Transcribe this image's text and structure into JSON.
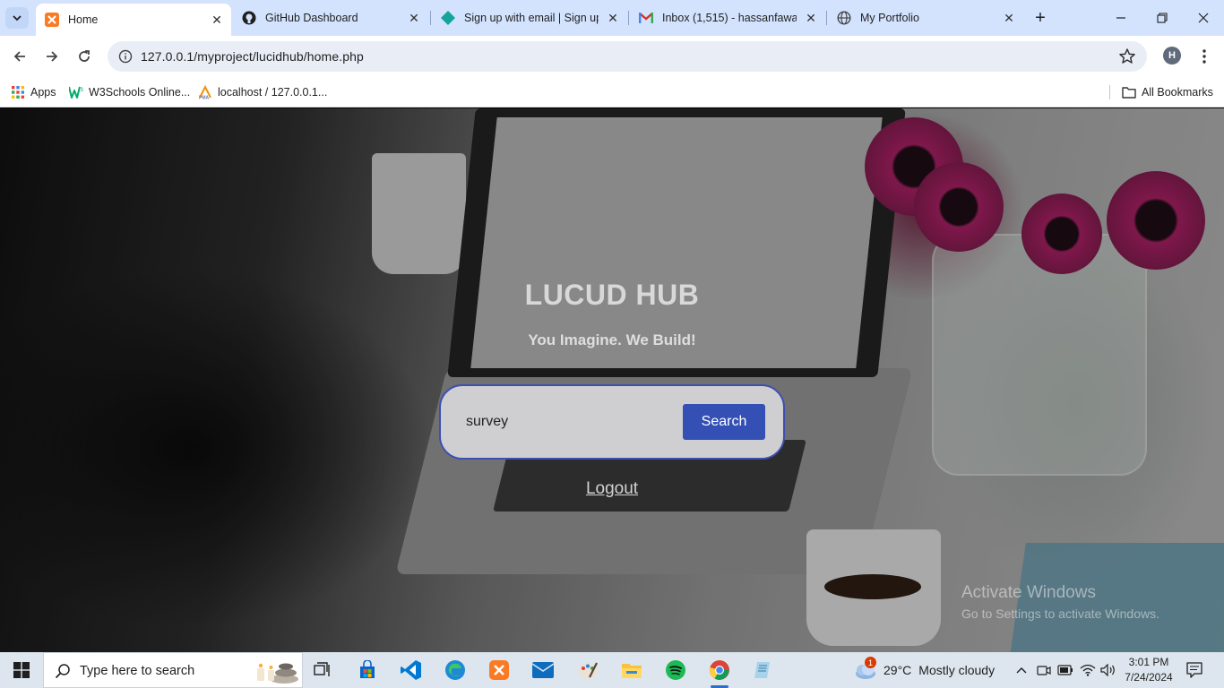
{
  "browser": {
    "tabs": [
      {
        "title": "Home",
        "active": true,
        "icon": "xampp-icon"
      },
      {
        "title": "GitHub Dashboard",
        "active": false,
        "icon": "github-icon"
      },
      {
        "title": "Sign up with email | Sign up",
        "active": false,
        "icon": "diamond-icon"
      },
      {
        "title": "Inbox (1,515) - hassanfawaz",
        "active": false,
        "icon": "gmail-icon"
      },
      {
        "title": "My Portfolio",
        "active": false,
        "icon": "globe-icon"
      }
    ],
    "url": "127.0.0.1/myproject/lucidhub/home.php",
    "profile_initial": "H",
    "bookmarks": [
      {
        "label": "Apps",
        "icon": "apps-grid-icon"
      },
      {
        "label": "W3Schools Online...",
        "icon": "w3schools-icon"
      },
      {
        "label": "localhost / 127.0.0.1...",
        "icon": "phpmyadmin-icon"
      }
    ],
    "all_bookmarks": "All Bookmarks"
  },
  "page": {
    "title": "LUCUD HUB",
    "tagline": "You Imagine. We Build!",
    "search_value": "survey",
    "search_button": "Search",
    "logout": "Logout",
    "activate_title": "Activate Windows",
    "activate_sub": "Go to Settings to activate Windows."
  },
  "taskbar": {
    "search_placeholder": "Type here to search",
    "weather_temp": "29°C",
    "weather_desc": "Mostly cloudy",
    "weather_badge": "1",
    "time": "3:01 PM",
    "date": "7/24/2024"
  },
  "colors": {
    "tabstrip": "#d3e3fd",
    "search_button": "#3550b5",
    "search_border": "#3d4fb0",
    "taskbar": "#dde6ee"
  }
}
